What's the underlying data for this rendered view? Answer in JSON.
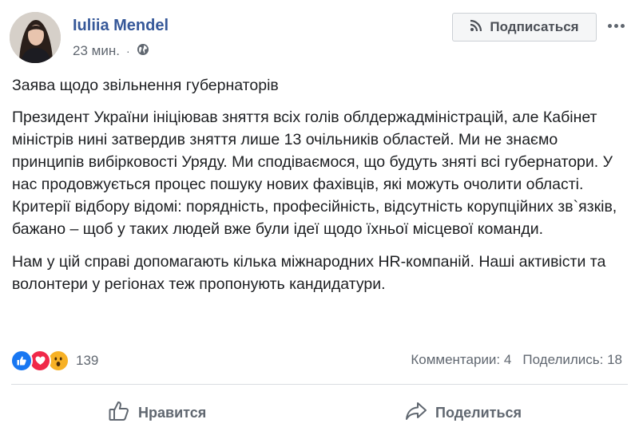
{
  "author": {
    "name": "Iuliia Mendel",
    "time": "23 мин.",
    "separator": "·",
    "audience_icon": "globe-icon"
  },
  "header": {
    "subscribe_label": "Подписаться",
    "subscribe_icon": "rss-icon",
    "more_icon": "more-dots-icon"
  },
  "post": {
    "title": "Заява щодо звільнення губернаторів",
    "paragraphs": [
      "Президент України ініціював зняття всіх голів облдержадміністрацій, але Кабінет міністрів нині затвердив зняття лише 13 очільників областей. Ми не знаємо принципів вибірковості Уряду. Ми сподіваємося, що будуть зняті всі губернатори. У нас продовжується процес пошуку нових фахівців, які можуть очолити області. Критерії відбору відомі: порядність, професійність, відсутність корупційних зв`язків, бажано – щоб у таких людей вже були ідеї щодо їхньої місцевої команди.",
      "Нам у цій справі допомагають кілька міжнародних HR-компаній. Наші активісти та волонтери у регіонах теж пропонують кандидатури."
    ]
  },
  "reactions": {
    "types": [
      "like",
      "love",
      "wow"
    ],
    "count": "139"
  },
  "stats": {
    "comments": "Комментарии: 4",
    "shares": "Поделились: 18"
  },
  "actions": {
    "like_label": "Нравится",
    "share_label": "Поделиться"
  },
  "colors": {
    "author_link": "#365899",
    "secondary_text": "#606770",
    "like_blue": "#1877f2",
    "love_red": "#f02849",
    "wow_yellow": "#f7b125"
  }
}
